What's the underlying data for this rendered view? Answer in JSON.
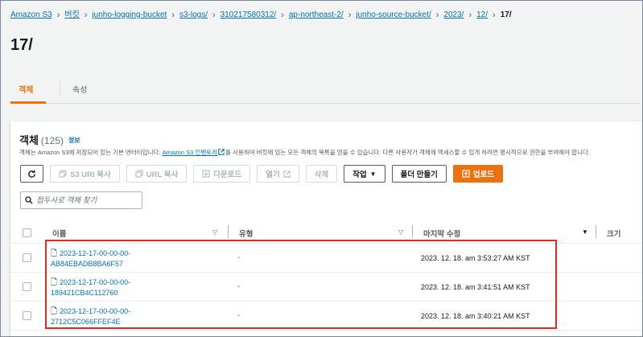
{
  "breadcrumb": [
    "Amazon S3",
    "버킷",
    "junho-logging-bucket",
    "s3-logs/",
    "310217580312/",
    "ap-northeast-2/",
    "junho-source-bucket/",
    "2023/",
    "12/"
  ],
  "breadcrumb_current": "17/",
  "page_title": "17/",
  "tabs": {
    "objects": "객체",
    "properties": "속성"
  },
  "objects": {
    "heading": "객체",
    "count": "(125)",
    "info": "정보",
    "desc_before": "객체는 Amazon S3에 저장되어 있는 기본 엔터티입니다. ",
    "desc_link": "Amazon S3 인벤토리",
    "desc_after": "를 사용하여 버킷에 있는 모든 객체의 목록을 얻을 수 있습니다. 다른 사용자가 객체에 액세스할 수 있게 하려면 명시적으로 권한을 부여해야 합니다."
  },
  "toolbar": {
    "copy_s3_uri": "S3 URI 복사",
    "copy_url": "URL 복사",
    "download": "다운로드",
    "open": "열기",
    "delete": "삭제",
    "actions": "작업",
    "create_folder": "폴더 만들기",
    "upload": "업로드"
  },
  "search": {
    "placeholder": "접두사로 객체 찾기"
  },
  "table": {
    "columns": {
      "name": "이름",
      "type": "유형",
      "modified": "마지막 수정",
      "size": "크기"
    },
    "rows": [
      {
        "name1": "2023-12-17-00-00-00-",
        "name2": "AB84EBADB8BA6F57",
        "type": "-",
        "modified": "2023. 12. 18. am 3:53:27 AM KST"
      },
      {
        "name1": "2023-12-17-00-00-00-",
        "name2": "189421CB4C112760",
        "type": "-",
        "modified": "2023. 12. 18. am 3:41:51 AM KST"
      },
      {
        "name1": "2023-12-17-00-00-00-",
        "name2": "2712C5C066FFEF4E",
        "type": "-",
        "modified": "2023. 12. 18. am 3:40:21 AM KST"
      }
    ]
  },
  "colors": {
    "link": "#0073bb",
    "accent": "#ec7211",
    "highlight": "#e02b2b"
  }
}
